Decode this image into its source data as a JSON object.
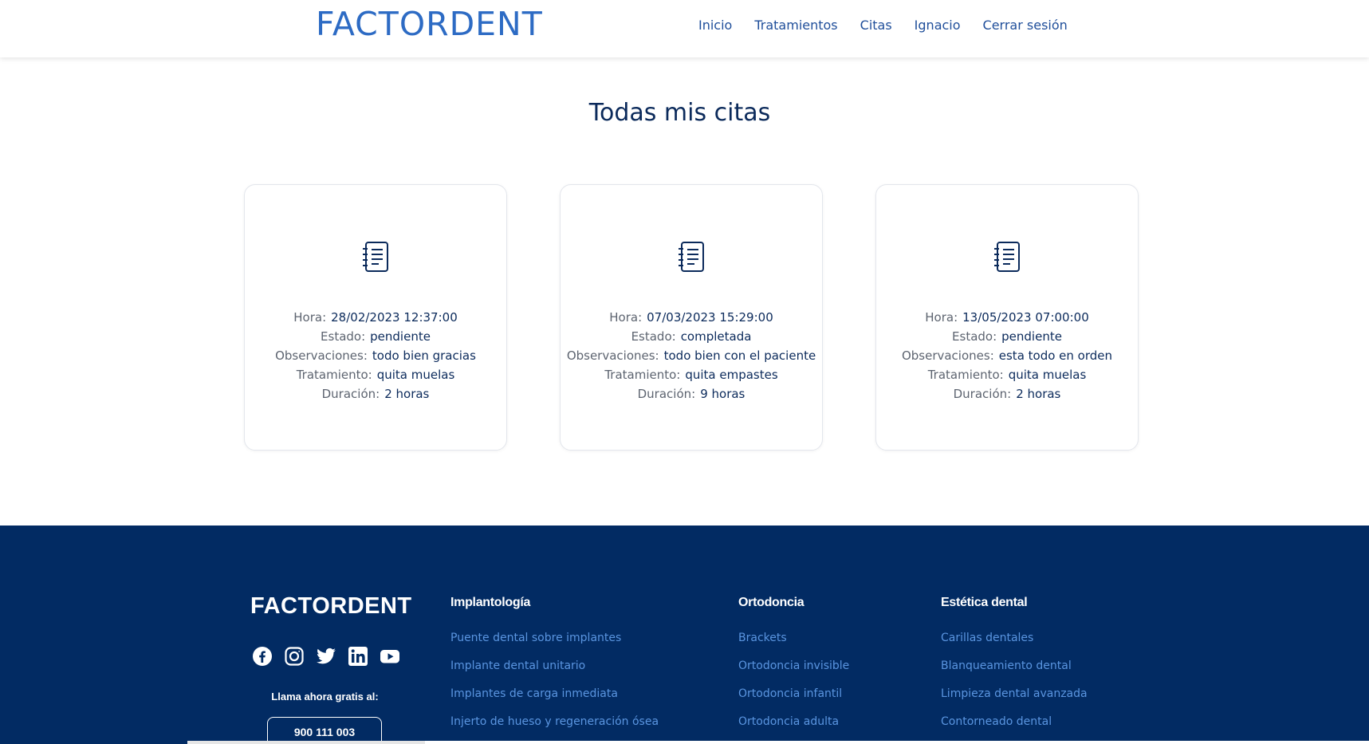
{
  "header": {
    "brand": "FACTORDENT",
    "nav": [
      "Inicio",
      "Tratamientos",
      "Citas",
      "Ignacio",
      "Cerrar sesión"
    ]
  },
  "main": {
    "title": "Todas mis citas",
    "labels": {
      "hora": "Hora:",
      "estado": "Estado:",
      "observaciones": "Observaciones:",
      "tratamiento": "Tratamiento:",
      "duracion": "Duración:"
    },
    "appointments": [
      {
        "hora": "28/02/2023 12:37:00",
        "estado": "pendiente",
        "observaciones": "todo bien gracias",
        "tratamiento": "quita muelas",
        "duracion": "2 horas"
      },
      {
        "hora": "07/03/2023 15:29:00",
        "estado": "completada",
        "observaciones": "todo bien con el paciente",
        "tratamiento": "quita empastes",
        "duracion": "9 horas"
      },
      {
        "hora": "13/05/2023 07:00:00",
        "estado": "pendiente",
        "observaciones": "esta todo en orden",
        "tratamiento": "quita muelas",
        "duracion": "2 horas"
      }
    ]
  },
  "footer": {
    "brand": "FACTORDENT",
    "socials": [
      "facebook-icon",
      "instagram-icon",
      "twitter-icon",
      "linkedin-icon",
      "youtube-icon"
    ],
    "call_label": "Llama ahora gratis al:",
    "phone": "900 111 003",
    "columns": [
      {
        "title": "Implantología",
        "links": [
          "Puente dental sobre implantes",
          "Implante dental unitario",
          "Implantes de carga inmediata",
          "Injerto de hueso y regeneración ósea"
        ]
      },
      {
        "title": "Ortodoncia",
        "links": [
          "Brackets",
          "Ortodoncia invisible",
          "Ortodoncia infantil",
          "Ortodoncia adulta"
        ]
      },
      {
        "title": "Estética dental",
        "links": [
          "Carillas dentales",
          "Blanqueamiento dental",
          "Limpieza dental avanzada",
          "Contorneado dental"
        ]
      }
    ]
  },
  "colors": {
    "brand_blue": "#2d6bc4",
    "nav_blue": "#1f4e9a",
    "footer_bg": "#022b63",
    "footer_link": "#5a95e0"
  }
}
